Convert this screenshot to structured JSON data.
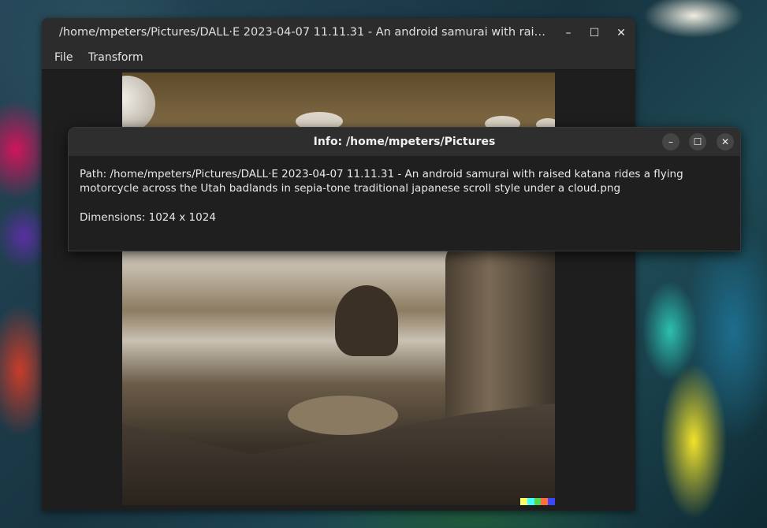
{
  "main_window": {
    "title": "/home/mpeters/Pictures/DALL·E 2023-04-07 11.11.31 - An android samurai with raised …",
    "controls": {
      "minimize": "–",
      "maximize": "☐",
      "close": "✕"
    },
    "menu": [
      "File",
      "Transform"
    ]
  },
  "image": {
    "strip_colors": [
      "#ffff66",
      "#42ffff",
      "#51da4c",
      "#ff6e3c",
      "#3c46ff"
    ]
  },
  "info_dialog": {
    "title": "Info: /home/mpeters/Pictures",
    "controls": {
      "minimize": "–",
      "maximize": "☐",
      "close": "✕"
    },
    "path_text": "Path: /home/mpeters/Pictures/DALL·E 2023-04-07 11.11.31 - An android samurai with raised katana rides a flying motorcycle across the Utah badlands in sepia-tone traditional japanese scroll style under a cloud.png",
    "dimensions_text": "Dimensions: 1024 x 1024"
  }
}
